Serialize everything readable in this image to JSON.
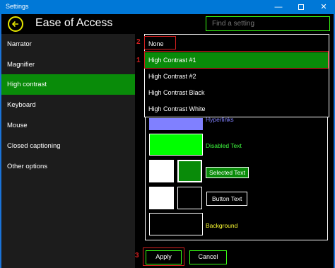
{
  "window": {
    "title": "Settings",
    "minimize": "—",
    "close": "✕"
  },
  "header": {
    "title": "Ease of Access",
    "search_placeholder": "Find a setting"
  },
  "sidebar": {
    "items": [
      {
        "label": "Narrator"
      },
      {
        "label": "Magnifier"
      },
      {
        "label": "High contrast",
        "selected": true
      },
      {
        "label": "Keyboard"
      },
      {
        "label": "Mouse"
      },
      {
        "label": "Closed captioning"
      },
      {
        "label": "Other options"
      }
    ]
  },
  "theme_dropdown": {
    "options": [
      "None",
      "High Contrast #1",
      "High Contrast #2",
      "High Contrast Black",
      "High Contrast White"
    ],
    "selected": "High Contrast #1"
  },
  "preview": {
    "hyperlinks": "Hyperlinks",
    "disabled_text": "Disabled Text",
    "selected_text": "Selected Text",
    "button_text": "Button Text",
    "background": "Background"
  },
  "colors": {
    "hyperlink": "#8080ff",
    "disabled": "#00ff00",
    "selected_bg": "#098b09",
    "background_text": "#ffff33",
    "accent_green": "#39ff14",
    "annotation_red": "#d42020",
    "titlebar": "#0078d7"
  },
  "annotations": {
    "one": "1",
    "two": "2",
    "three": "3"
  },
  "actions": {
    "apply": "Apply",
    "cancel": "Cancel"
  }
}
